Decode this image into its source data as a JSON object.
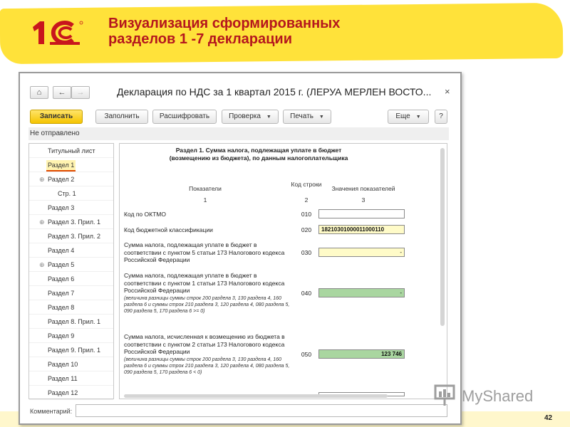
{
  "slide": {
    "title_line1": "Визуализация сформированных",
    "title_line2": "разделов 1 -7 декларации",
    "page_number": "42",
    "logo_text": "1С",
    "watermark": "MyShared"
  },
  "window": {
    "doc_title": "Декларация по НДС за 1 квартал 2015 г. (ЛЕРУА МЕРЛЕН ВОСТО...",
    "close": "×",
    "toolbar": {
      "save": "Записать",
      "fill": "Заполнить",
      "decode": "Расшифровать",
      "check": "Проверка",
      "print": "Печать",
      "more": "Еще",
      "help": "?"
    },
    "status": "Не отправлено",
    "comment_label": "Комментарий:"
  },
  "sidebar": {
    "items": [
      {
        "label": "Титульный лист"
      },
      {
        "label": "Раздел 1"
      },
      {
        "label": "Раздел 2"
      },
      {
        "label": "Стр. 1"
      },
      {
        "label": "Раздел 3"
      },
      {
        "label": "Раздел 3. Прил. 1"
      },
      {
        "label": "Раздел 3. Прил. 2"
      },
      {
        "label": "Раздел 4"
      },
      {
        "label": "Раздел 5"
      },
      {
        "label": "Раздел 6"
      },
      {
        "label": "Раздел 7"
      },
      {
        "label": "Раздел 8"
      },
      {
        "label": "Раздел 8. Прил. 1"
      },
      {
        "label": "Раздел 9"
      },
      {
        "label": "Раздел 9. Прил. 1"
      },
      {
        "label": "Раздел 10"
      },
      {
        "label": "Раздел 11"
      },
      {
        "label": "Раздел 12"
      }
    ]
  },
  "form": {
    "section_title": "Раздел 1. Сумма налога, подлежащая уплате в бюджет (возмещению из бюджета), по данным налогоплательщика",
    "headers": {
      "indicators": "Показатели",
      "code": "Код строки",
      "values": "Значения показателей",
      "n1": "1",
      "n2": "2",
      "n3": "3"
    },
    "rows": [
      {
        "text": "Код по ОКТМО",
        "code": "010",
        "value": ""
      },
      {
        "text": "Код бюджетной классификации",
        "code": "020",
        "value": "18210301000011000110"
      },
      {
        "text": "Сумма налога, подлежащая уплате в бюджет в соответствии с пунктом 5 статьи 173 Налогового кодекса Российской Федерации",
        "code": "030",
        "value": "-"
      },
      {
        "text": "Сумма налога, подлежащая уплате в бюджет в соответствии с пунктом 1 статьи 173 Налогового кодекса Российской Федерации",
        "note": "(величина разницы суммы строк 200 раздела 3, 130 раздела 4, 160 раздела 6 и суммы строк 210 раздела 3, 120 раздела 4, 080 раздела 5, 090 раздела 5, 170 раздела 6 >= 0)",
        "code": "040",
        "value": "-"
      },
      {
        "text": "Сумма налога, исчисленная к возмещению из бюджета в соответствии с пунктом 2 статьи 173 Налогового кодекса Российской Федерации",
        "note": "(величина разницы суммы строк 200 раздела 3, 130 раздела 4, 160 раздела 6 и суммы строк 210 раздела 3, 120 раздела 4, 080 раздела 5, 090 раздела 5, 170 раздела 6 < 0)",
        "code": "050",
        "value": "123 746"
      }
    ]
  },
  "colors": {
    "brand_red": "#b5171e",
    "highlight_yellow": "#ffe23a",
    "field_green": "#a9d6a0"
  }
}
